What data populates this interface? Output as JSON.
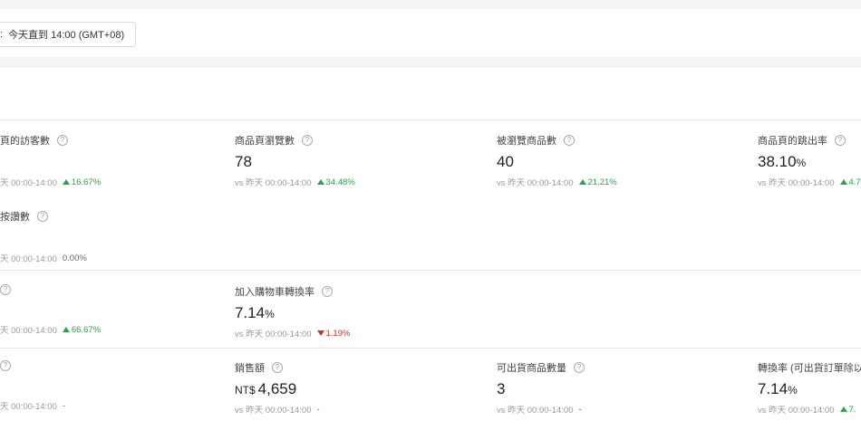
{
  "period": {
    "colon": ":",
    "value": "今天直到 14:00 (GMT+08)"
  },
  "colors": {
    "up": "#2ba24c",
    "down": "#d0312d"
  },
  "metrics": {
    "visitors": {
      "label": "頁的訪客數",
      "compare": "天 00:00-14:00",
      "change": "16.67%",
      "direction": "up"
    },
    "pageviews": {
      "label": "商品頁瀏覽數",
      "value": "78",
      "compare": "vs 昨天 00:00-14:00",
      "change": "34.48%",
      "direction": "up"
    },
    "viewed_products": {
      "label": "被瀏覽商品數",
      "value": "40",
      "compare": "vs 昨天 00:00-14:00",
      "change": "21.21%",
      "direction": "up"
    },
    "bounce_rate": {
      "label": "商品頁的跳出率",
      "value": "38.10",
      "unit": "%",
      "compare": "vs 昨天 00:00-14:00",
      "change": "4.7",
      "direction": "up"
    },
    "likes": {
      "label": "按讚數",
      "compare": "天 00:00-14:00",
      "change": "0.00%"
    },
    "row3_left": {
      "compare": "天 00:00-14:00",
      "change": "66.67%",
      "direction": "up"
    },
    "add_to_cart_rate": {
      "label": "加入購物車轉換率",
      "value": "7.14",
      "unit": "%",
      "compare": "vs 昨天 00:00-14:00",
      "change": "1.19%",
      "direction": "down"
    },
    "row4_left": {
      "compare": "天 00:00-14:00",
      "change": "-"
    },
    "sales": {
      "label": "銷售額",
      "prefix": "NT$",
      "value": "4,659",
      "compare": "vs 昨天 00:00-14:00",
      "change": "-"
    },
    "shippable_qty": {
      "label": "可出貨商品數量",
      "value": "3",
      "compare": "vs 昨天 00:00-14:00",
      "change": "-"
    },
    "conversion_rate": {
      "label": "轉換率 (可出貨訂單除以",
      "value": "7.14",
      "unit": "%",
      "compare": "vs 昨天 00:00-14:00",
      "change": "7."
    }
  }
}
